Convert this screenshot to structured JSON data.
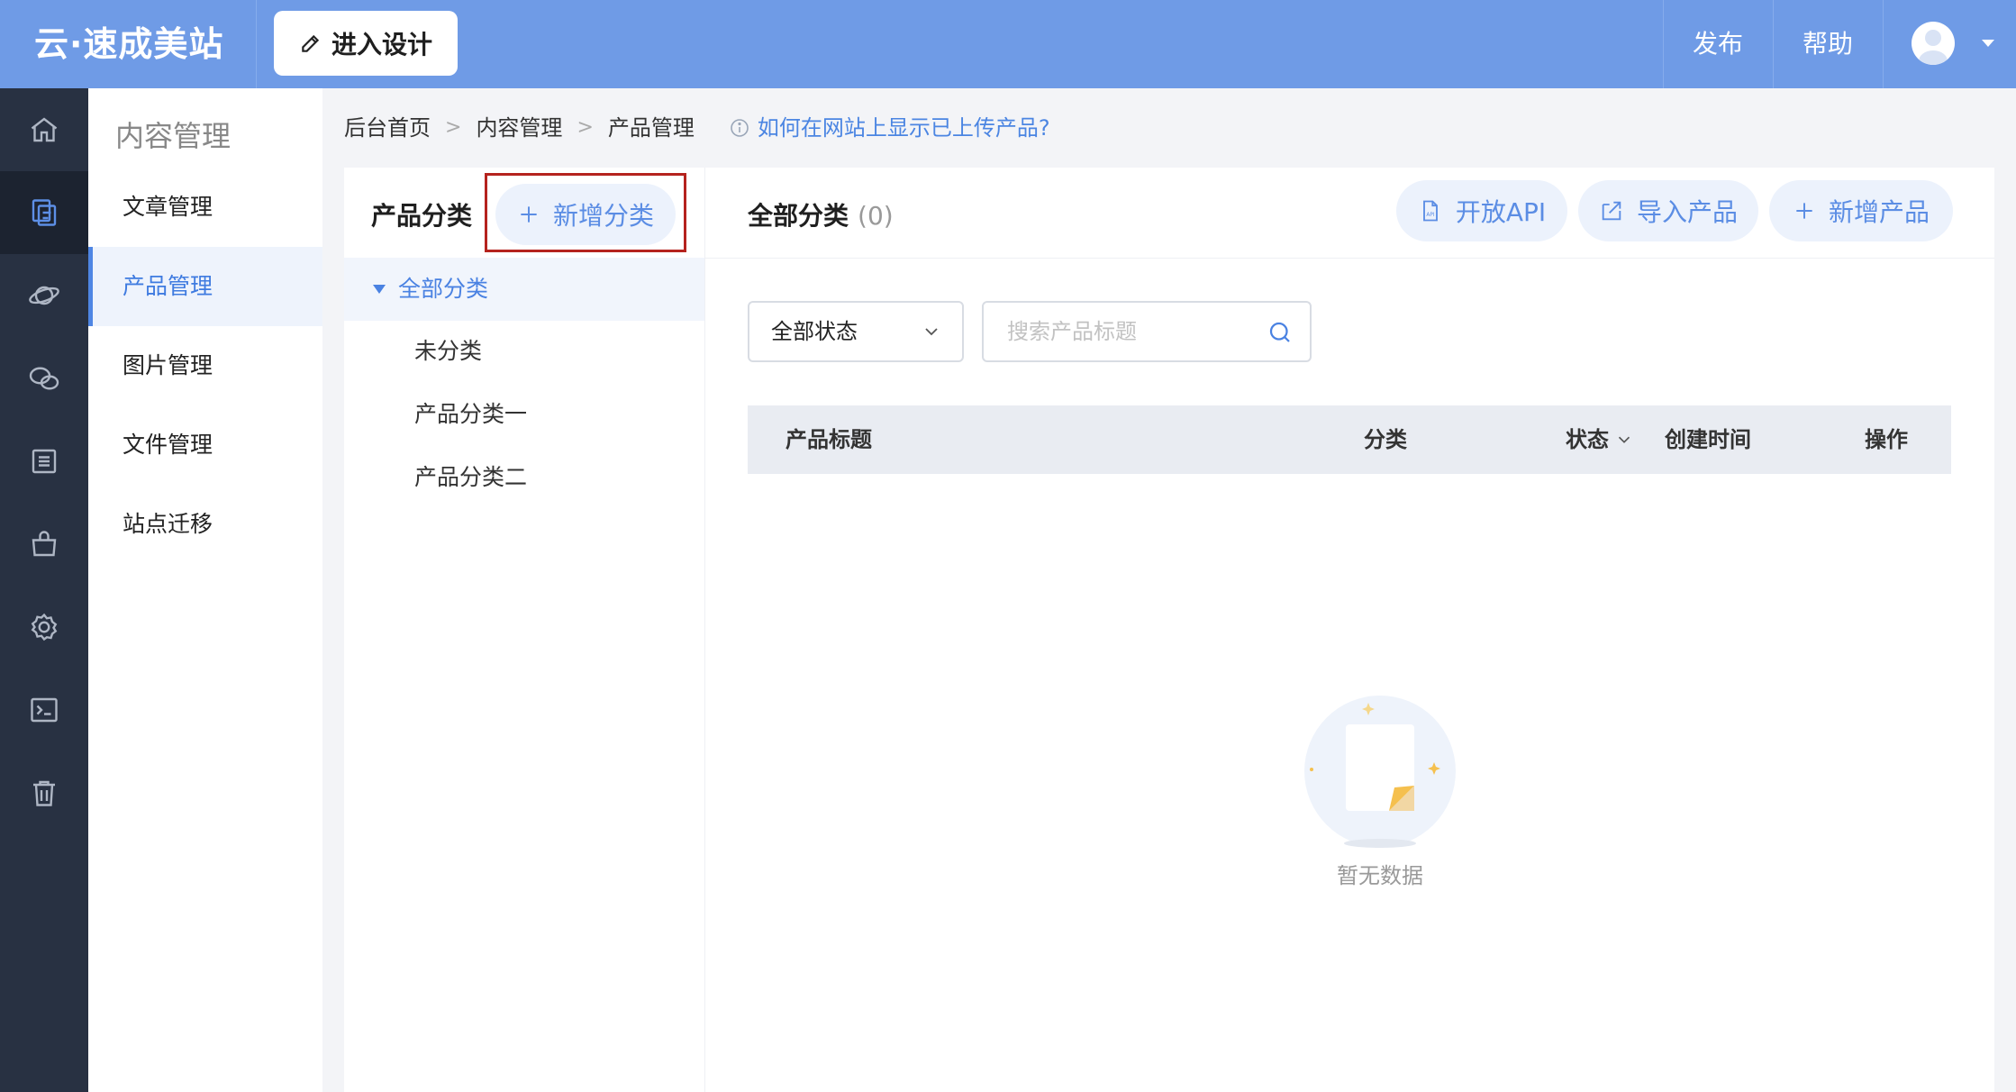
{
  "topbar": {
    "logo": "云·速成美站",
    "design_button": "进入设计",
    "publish": "发布",
    "help": "帮助"
  },
  "rail": {
    "items": [
      "home-icon",
      "content-icon",
      "planet-icon",
      "wechat-icon",
      "list-icon",
      "shop-icon",
      "settings-icon",
      "terminal-icon",
      "trash-icon"
    ],
    "active_index": 1
  },
  "submenu": {
    "title": "内容管理",
    "items": [
      {
        "label": "文章管理"
      },
      {
        "label": "产品管理"
      },
      {
        "label": "图片管理"
      },
      {
        "label": "文件管理"
      },
      {
        "label": "站点迁移"
      }
    ],
    "active_index": 1
  },
  "breadcrumb": {
    "items": [
      "后台首页",
      "内容管理",
      "产品管理"
    ],
    "help_link": "如何在网站上显示已上传产品?"
  },
  "category_panel": {
    "title": "产品分类",
    "add_button": "新增分类",
    "all_label": "全部分类",
    "items": [
      "未分类",
      "产品分类一",
      "产品分类二"
    ]
  },
  "product_panel": {
    "title": "全部分类",
    "count": "(0)",
    "buttons": {
      "api": "开放API",
      "import": "导入产品",
      "add": "新增产品"
    },
    "status_filter": "全部状态",
    "search_placeholder": "搜索产品标题",
    "columns": {
      "title": "产品标题",
      "category": "分类",
      "status": "状态",
      "created": "创建时间",
      "actions": "操作"
    },
    "empty_text": "暂无数据"
  },
  "colors": {
    "topbar": "#6f9be6",
    "rail": "#283142",
    "accent": "#4a82e2",
    "highlight_box": "#b5231e"
  }
}
